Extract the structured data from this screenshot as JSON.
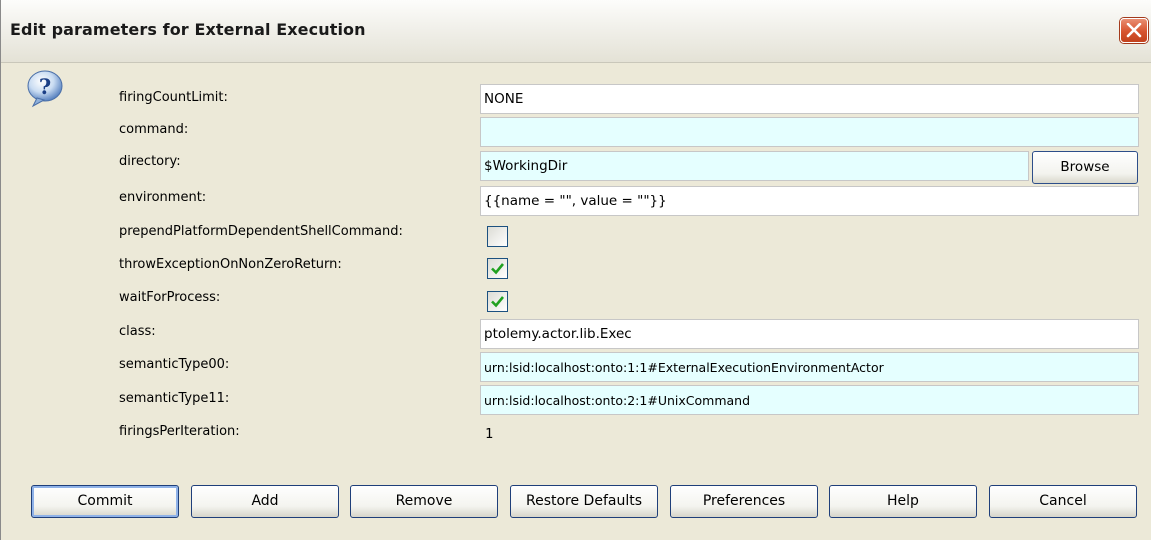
{
  "window": {
    "title": "Edit parameters for External Execution"
  },
  "icons": {
    "help": "question-mark-icon",
    "close": "close-x-icon",
    "checked": "checkmark-icon"
  },
  "colors": {
    "field_cyan": "#e5ffff",
    "checkmark": "#21a121",
    "close_red": "#d7542f"
  },
  "params": {
    "firingCountLimit": {
      "label": "firingCountLimit:",
      "value": "NONE"
    },
    "command": {
      "label": "command:",
      "value": ""
    },
    "directory": {
      "label": "directory:",
      "value": "$WorkingDir",
      "browse_label": "Browse"
    },
    "environment": {
      "label": "environment:",
      "value": "{{name = \"\", value = \"\"}}"
    },
    "prepend": {
      "label": "prependPlatformDependentShellCommand:",
      "checked": false
    },
    "throwException": {
      "label": "throwExceptionOnNonZeroReturn:",
      "checked": true
    },
    "waitForProcess": {
      "label": "waitForProcess:",
      "checked": true
    },
    "class": {
      "label": "class:",
      "value": "ptolemy.actor.lib.Exec"
    },
    "semanticType00": {
      "label": "semanticType00:",
      "value": "urn:lsid:localhost:onto:1:1#ExternalExecutionEnvironmentActor"
    },
    "semanticType11": {
      "label": "semanticType11:",
      "value": "urn:lsid:localhost:onto:2:1#UnixCommand"
    },
    "firingsPerIteration": {
      "label": "firingsPerIteration:",
      "value": "1"
    }
  },
  "buttons": {
    "commit": "Commit",
    "add": "Add",
    "remove": "Remove",
    "restore": "Restore Defaults",
    "preferences": "Preferences",
    "help": "Help",
    "cancel": "Cancel"
  }
}
